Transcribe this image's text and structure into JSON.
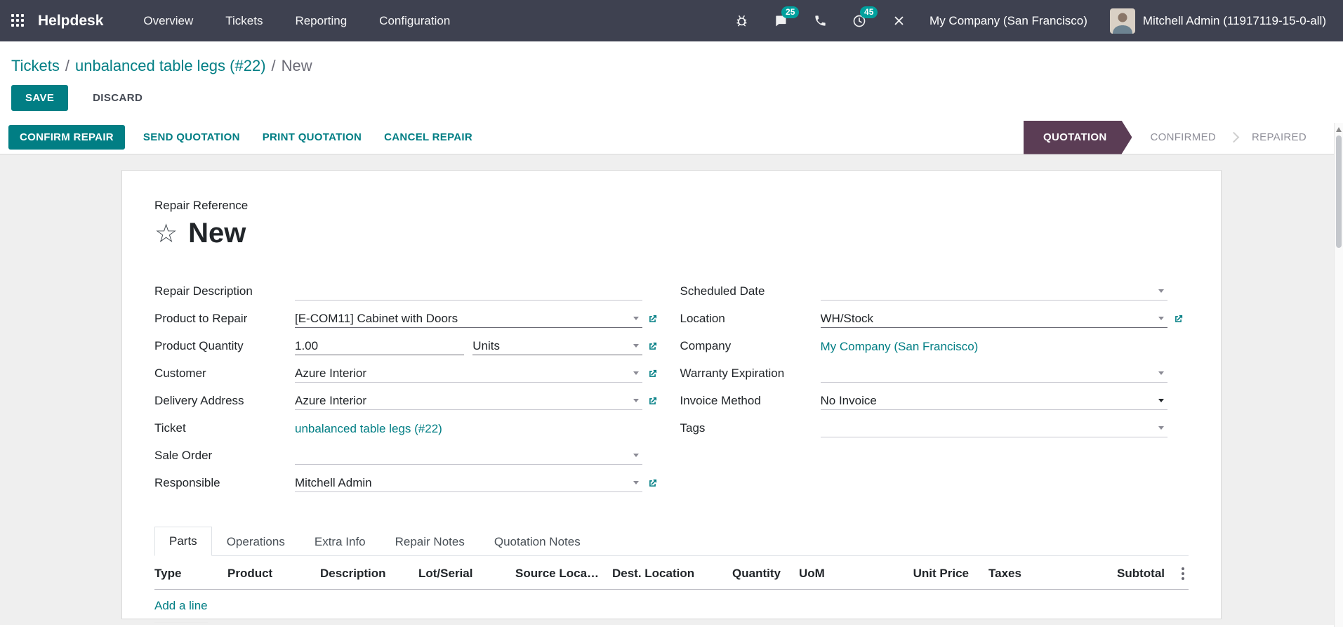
{
  "colors": {
    "navbar_bg": "#3e4150",
    "accent_teal": "#017e84",
    "badge_teal": "#00a09d",
    "stage_active_bg": "#5b3d55",
    "content_bg": "#efefef",
    "link": "#017e84"
  },
  "navbar": {
    "app_name": "Helpdesk",
    "menu": [
      "Overview",
      "Tickets",
      "Reporting",
      "Configuration"
    ],
    "messages_badge": "25",
    "activities_badge": "45",
    "company": "My Company (San Francisco)",
    "user": "Mitchell Admin (11917119-15-0-all)"
  },
  "breadcrumb": {
    "parent": "Tickets",
    "record": "unbalanced table legs (#22)",
    "current": "New",
    "separator": "/"
  },
  "controls": {
    "save": "SAVE",
    "discard": "DISCARD"
  },
  "actions": {
    "confirm_repair": "CONFIRM REPAIR",
    "send_quotation": "SEND QUOTATION",
    "print_quotation": "PRINT QUOTATION",
    "cancel_repair": "CANCEL REPAIR"
  },
  "statusbar": {
    "stages": [
      "QUOTATION",
      "CONFIRMED",
      "REPAIRED"
    ],
    "active_stage": "QUOTATION"
  },
  "form": {
    "reference_label": "Repair Reference",
    "reference_value": "New",
    "left": {
      "repair_description": {
        "label": "Repair Description",
        "value": ""
      },
      "product_to_repair": {
        "label": "Product to Repair",
        "value": "[E-COM11] Cabinet with Doors"
      },
      "product_quantity": {
        "label": "Product Quantity",
        "value": "1.00",
        "uom": "Units"
      },
      "customer": {
        "label": "Customer",
        "value": "Azure Interior"
      },
      "delivery_address": {
        "label": "Delivery Address",
        "value": "Azure Interior"
      },
      "ticket": {
        "label": "Ticket",
        "value": "unbalanced table legs (#22)"
      },
      "sale_order": {
        "label": "Sale Order",
        "value": ""
      },
      "responsible": {
        "label": "Responsible",
        "value": "Mitchell Admin"
      }
    },
    "right": {
      "scheduled_date": {
        "label": "Scheduled Date",
        "value": ""
      },
      "location": {
        "label": "Location",
        "value": "WH/Stock"
      },
      "company": {
        "label": "Company",
        "value": "My Company (San Francisco)"
      },
      "warranty_expiration": {
        "label": "Warranty Expiration",
        "value": ""
      },
      "invoice_method": {
        "label": "Invoice Method",
        "value": "No Invoice"
      },
      "tags": {
        "label": "Tags",
        "value": ""
      }
    }
  },
  "notebook": {
    "tabs": [
      "Parts",
      "Operations",
      "Extra Info",
      "Repair Notes",
      "Quotation Notes"
    ],
    "active_tab": "Parts"
  },
  "parts_table": {
    "columns": [
      "Type",
      "Product",
      "Description",
      "Lot/Serial",
      "Source Loca…",
      "Dest. Location",
      "Quantity",
      "UoM",
      "Unit Price",
      "Taxes",
      "Subtotal"
    ],
    "add_line_label": "Add a line",
    "rows": []
  }
}
